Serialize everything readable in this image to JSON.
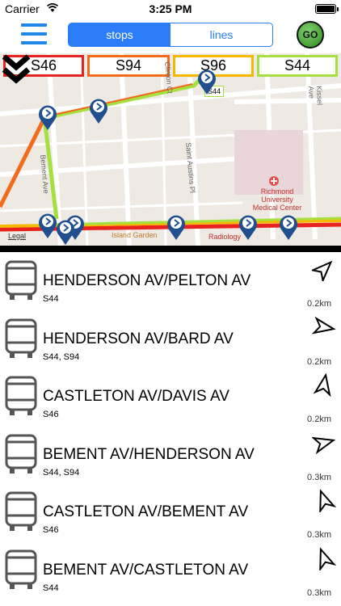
{
  "status_bar": {
    "carrier": "Carrier",
    "time": "3:25 PM"
  },
  "nav": {
    "tabs": [
      {
        "label": "stops",
        "active": true
      },
      {
        "label": "lines",
        "active": false
      }
    ],
    "go_label": "GO"
  },
  "route_tabs": [
    {
      "label": "S46",
      "color": "#e8231f"
    },
    {
      "label": "S94",
      "color": "#f26b1d"
    },
    {
      "label": "S96",
      "color": "#f5b800"
    },
    {
      "label": "S44",
      "color": "#a6e040"
    }
  ],
  "map": {
    "legal": "Legal",
    "stop_callout": "S44",
    "labels": [
      "Bement Ave",
      "Saint Austins Pl",
      "Richmond University Medical Center",
      "Radiology",
      "Island Garden",
      "Clinton Ct",
      "Kissel Ave"
    ]
  },
  "stops": [
    {
      "name": "HENDERSON AV/PELTON AV",
      "routes": "S44",
      "distance": "0.2km",
      "bearing": 45
    },
    {
      "name": "HENDERSON AV/BARD AV",
      "routes": "S44, S94",
      "distance": "0.2km",
      "bearing": 100
    },
    {
      "name": "CASTLETON AV/DAVIS AV",
      "routes": "S46",
      "distance": "0.2km",
      "bearing": 10
    },
    {
      "name": "BEMENT AV/HENDERSON AV",
      "routes": "S44, S94",
      "distance": "0.3km",
      "bearing": 75
    },
    {
      "name": "CASTLETON AV/BEMENT AV",
      "routes": "S46",
      "distance": "0.3km",
      "bearing": -20
    },
    {
      "name": "BEMENT AV/CASTLETON AV",
      "routes": "S44",
      "distance": "0.3km",
      "bearing": -20
    }
  ]
}
